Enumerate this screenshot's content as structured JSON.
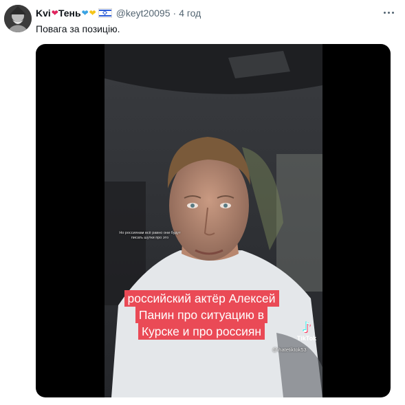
{
  "tweet": {
    "display_name": "Kvi",
    "display_name_suffix": "Тень",
    "handle": "@keyt20095",
    "separator": "·",
    "time": "4 год",
    "text": "Повага за позицію."
  },
  "video": {
    "small_subtitle": "Но россиянам всё равно они будут писать шутки про это",
    "caption_lines": [
      "российский актёр Алексей",
      "Панин про ситуацию в",
      "Курске и про россиян"
    ],
    "watermark_brand": "TikTok",
    "watermark_user": "@ihatetiktok53"
  },
  "icons": {
    "more": "more-horizontal-icon",
    "tiktok": "tiktok-logo-icon"
  },
  "colors": {
    "caption_bg": "#ea4a56",
    "secondary_text": "#536471"
  }
}
